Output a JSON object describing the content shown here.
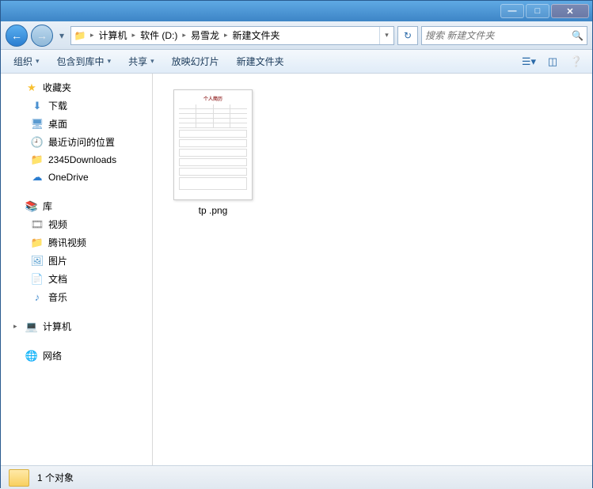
{
  "window": {
    "min": "—",
    "max": "□",
    "close": "✕"
  },
  "address": {
    "crumbs": [
      "计算机",
      "软件 (D:)",
      "易雪龙",
      "新建文件夹"
    ]
  },
  "search": {
    "placeholder": "搜索 新建文件夹"
  },
  "toolbar": {
    "organize": "组织",
    "include": "包含到库中",
    "share": "共享",
    "slideshow": "放映幻灯片",
    "newfolder": "新建文件夹"
  },
  "sidebar": {
    "favorites": {
      "label": "收藏夹",
      "items": [
        {
          "icon": "download",
          "label": "下载"
        },
        {
          "icon": "desktop",
          "label": "桌面"
        },
        {
          "icon": "recent",
          "label": "最近访问的位置"
        },
        {
          "icon": "folder",
          "label": "2345Downloads"
        },
        {
          "icon": "onedrive",
          "label": "OneDrive"
        }
      ]
    },
    "libraries": {
      "label": "库",
      "items": [
        {
          "icon": "video",
          "label": "视频"
        },
        {
          "icon": "folder",
          "label": "腾讯视频"
        },
        {
          "icon": "pictures",
          "label": "图片"
        },
        {
          "icon": "documents",
          "label": "文档"
        },
        {
          "icon": "music",
          "label": "音乐"
        }
      ]
    },
    "computer": {
      "label": "计算机"
    },
    "network": {
      "label": "网络"
    }
  },
  "files": [
    {
      "name": "tp .png",
      "thumb_title": "个人简历"
    }
  ],
  "status": {
    "count": "1 个对象"
  }
}
